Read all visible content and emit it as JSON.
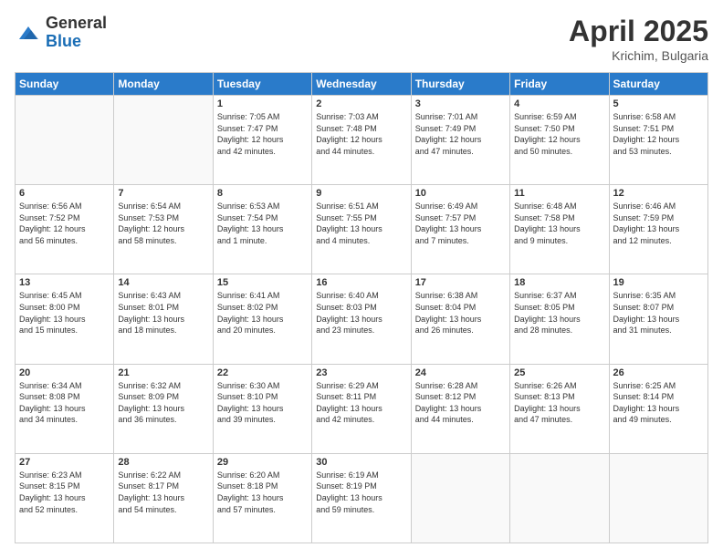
{
  "header": {
    "logo_general": "General",
    "logo_blue": "Blue",
    "month_title": "April 2025",
    "location": "Krichim, Bulgaria"
  },
  "days_of_week": [
    "Sunday",
    "Monday",
    "Tuesday",
    "Wednesday",
    "Thursday",
    "Friday",
    "Saturday"
  ],
  "weeks": [
    [
      {
        "day": "",
        "empty": true
      },
      {
        "day": "",
        "empty": true
      },
      {
        "day": "1",
        "line1": "Sunrise: 7:05 AM",
        "line2": "Sunset: 7:47 PM",
        "line3": "Daylight: 12 hours",
        "line4": "and 42 minutes."
      },
      {
        "day": "2",
        "line1": "Sunrise: 7:03 AM",
        "line2": "Sunset: 7:48 PM",
        "line3": "Daylight: 12 hours",
        "line4": "and 44 minutes."
      },
      {
        "day": "3",
        "line1": "Sunrise: 7:01 AM",
        "line2": "Sunset: 7:49 PM",
        "line3": "Daylight: 12 hours",
        "line4": "and 47 minutes."
      },
      {
        "day": "4",
        "line1": "Sunrise: 6:59 AM",
        "line2": "Sunset: 7:50 PM",
        "line3": "Daylight: 12 hours",
        "line4": "and 50 minutes."
      },
      {
        "day": "5",
        "line1": "Sunrise: 6:58 AM",
        "line2": "Sunset: 7:51 PM",
        "line3": "Daylight: 12 hours",
        "line4": "and 53 minutes."
      }
    ],
    [
      {
        "day": "6",
        "line1": "Sunrise: 6:56 AM",
        "line2": "Sunset: 7:52 PM",
        "line3": "Daylight: 12 hours",
        "line4": "and 56 minutes."
      },
      {
        "day": "7",
        "line1": "Sunrise: 6:54 AM",
        "line2": "Sunset: 7:53 PM",
        "line3": "Daylight: 12 hours",
        "line4": "and 58 minutes."
      },
      {
        "day": "8",
        "line1": "Sunrise: 6:53 AM",
        "line2": "Sunset: 7:54 PM",
        "line3": "Daylight: 13 hours",
        "line4": "and 1 minute."
      },
      {
        "day": "9",
        "line1": "Sunrise: 6:51 AM",
        "line2": "Sunset: 7:55 PM",
        "line3": "Daylight: 13 hours",
        "line4": "and 4 minutes."
      },
      {
        "day": "10",
        "line1": "Sunrise: 6:49 AM",
        "line2": "Sunset: 7:57 PM",
        "line3": "Daylight: 13 hours",
        "line4": "and 7 minutes."
      },
      {
        "day": "11",
        "line1": "Sunrise: 6:48 AM",
        "line2": "Sunset: 7:58 PM",
        "line3": "Daylight: 13 hours",
        "line4": "and 9 minutes."
      },
      {
        "day": "12",
        "line1": "Sunrise: 6:46 AM",
        "line2": "Sunset: 7:59 PM",
        "line3": "Daylight: 13 hours",
        "line4": "and 12 minutes."
      }
    ],
    [
      {
        "day": "13",
        "line1": "Sunrise: 6:45 AM",
        "line2": "Sunset: 8:00 PM",
        "line3": "Daylight: 13 hours",
        "line4": "and 15 minutes."
      },
      {
        "day": "14",
        "line1": "Sunrise: 6:43 AM",
        "line2": "Sunset: 8:01 PM",
        "line3": "Daylight: 13 hours",
        "line4": "and 18 minutes."
      },
      {
        "day": "15",
        "line1": "Sunrise: 6:41 AM",
        "line2": "Sunset: 8:02 PM",
        "line3": "Daylight: 13 hours",
        "line4": "and 20 minutes."
      },
      {
        "day": "16",
        "line1": "Sunrise: 6:40 AM",
        "line2": "Sunset: 8:03 PM",
        "line3": "Daylight: 13 hours",
        "line4": "and 23 minutes."
      },
      {
        "day": "17",
        "line1": "Sunrise: 6:38 AM",
        "line2": "Sunset: 8:04 PM",
        "line3": "Daylight: 13 hours",
        "line4": "and 26 minutes."
      },
      {
        "day": "18",
        "line1": "Sunrise: 6:37 AM",
        "line2": "Sunset: 8:05 PM",
        "line3": "Daylight: 13 hours",
        "line4": "and 28 minutes."
      },
      {
        "day": "19",
        "line1": "Sunrise: 6:35 AM",
        "line2": "Sunset: 8:07 PM",
        "line3": "Daylight: 13 hours",
        "line4": "and 31 minutes."
      }
    ],
    [
      {
        "day": "20",
        "line1": "Sunrise: 6:34 AM",
        "line2": "Sunset: 8:08 PM",
        "line3": "Daylight: 13 hours",
        "line4": "and 34 minutes."
      },
      {
        "day": "21",
        "line1": "Sunrise: 6:32 AM",
        "line2": "Sunset: 8:09 PM",
        "line3": "Daylight: 13 hours",
        "line4": "and 36 minutes."
      },
      {
        "day": "22",
        "line1": "Sunrise: 6:30 AM",
        "line2": "Sunset: 8:10 PM",
        "line3": "Daylight: 13 hours",
        "line4": "and 39 minutes."
      },
      {
        "day": "23",
        "line1": "Sunrise: 6:29 AM",
        "line2": "Sunset: 8:11 PM",
        "line3": "Daylight: 13 hours",
        "line4": "and 42 minutes."
      },
      {
        "day": "24",
        "line1": "Sunrise: 6:28 AM",
        "line2": "Sunset: 8:12 PM",
        "line3": "Daylight: 13 hours",
        "line4": "and 44 minutes."
      },
      {
        "day": "25",
        "line1": "Sunrise: 6:26 AM",
        "line2": "Sunset: 8:13 PM",
        "line3": "Daylight: 13 hours",
        "line4": "and 47 minutes."
      },
      {
        "day": "26",
        "line1": "Sunrise: 6:25 AM",
        "line2": "Sunset: 8:14 PM",
        "line3": "Daylight: 13 hours",
        "line4": "and 49 minutes."
      }
    ],
    [
      {
        "day": "27",
        "line1": "Sunrise: 6:23 AM",
        "line2": "Sunset: 8:15 PM",
        "line3": "Daylight: 13 hours",
        "line4": "and 52 minutes."
      },
      {
        "day": "28",
        "line1": "Sunrise: 6:22 AM",
        "line2": "Sunset: 8:17 PM",
        "line3": "Daylight: 13 hours",
        "line4": "and 54 minutes."
      },
      {
        "day": "29",
        "line1": "Sunrise: 6:20 AM",
        "line2": "Sunset: 8:18 PM",
        "line3": "Daylight: 13 hours",
        "line4": "and 57 minutes."
      },
      {
        "day": "30",
        "line1": "Sunrise: 6:19 AM",
        "line2": "Sunset: 8:19 PM",
        "line3": "Daylight: 13 hours",
        "line4": "and 59 minutes."
      },
      {
        "day": "",
        "empty": true
      },
      {
        "day": "",
        "empty": true
      },
      {
        "day": "",
        "empty": true
      }
    ]
  ]
}
